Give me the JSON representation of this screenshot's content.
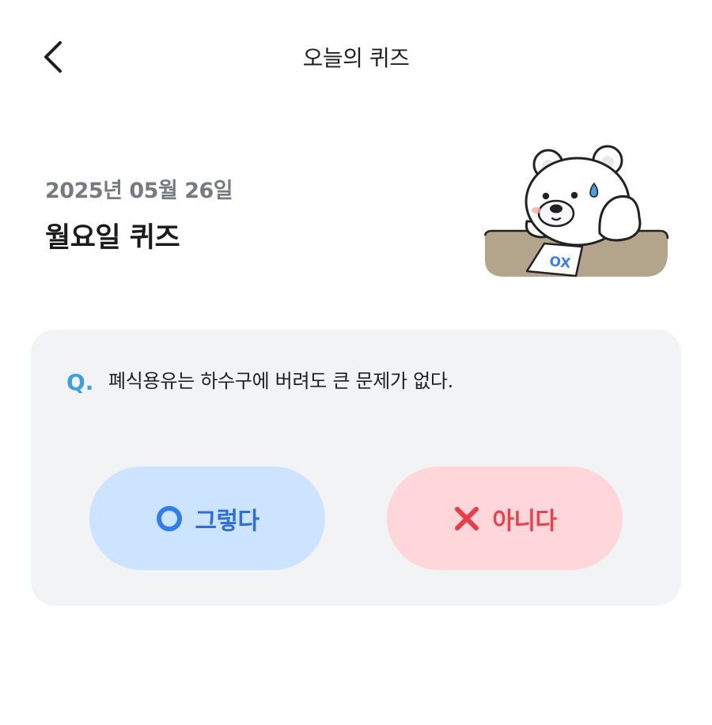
{
  "header": {
    "title": "오늘의 퀴즈",
    "back_icon": "chevron-left-icon"
  },
  "quiz": {
    "date": "2025년 05월 26일",
    "title": "월요일 퀴즈",
    "question_prefix": "Q.",
    "question": "폐식용유는 하수구에 버려도 큰 문제가 없다."
  },
  "illustration": {
    "card_text": "OX"
  },
  "answers": {
    "yes_label": "그렇다",
    "yes_icon": "circle-o-icon",
    "no_label": "아니다",
    "no_icon": "x-icon"
  },
  "colors": {
    "accent_blue": "#2f6fd4",
    "yes_bg": "#cce4ff",
    "accent_red": "#e8424d",
    "no_bg": "#ffd6d9",
    "card_bg": "#f2f3f5",
    "question_mark": "#3d9fe0"
  }
}
